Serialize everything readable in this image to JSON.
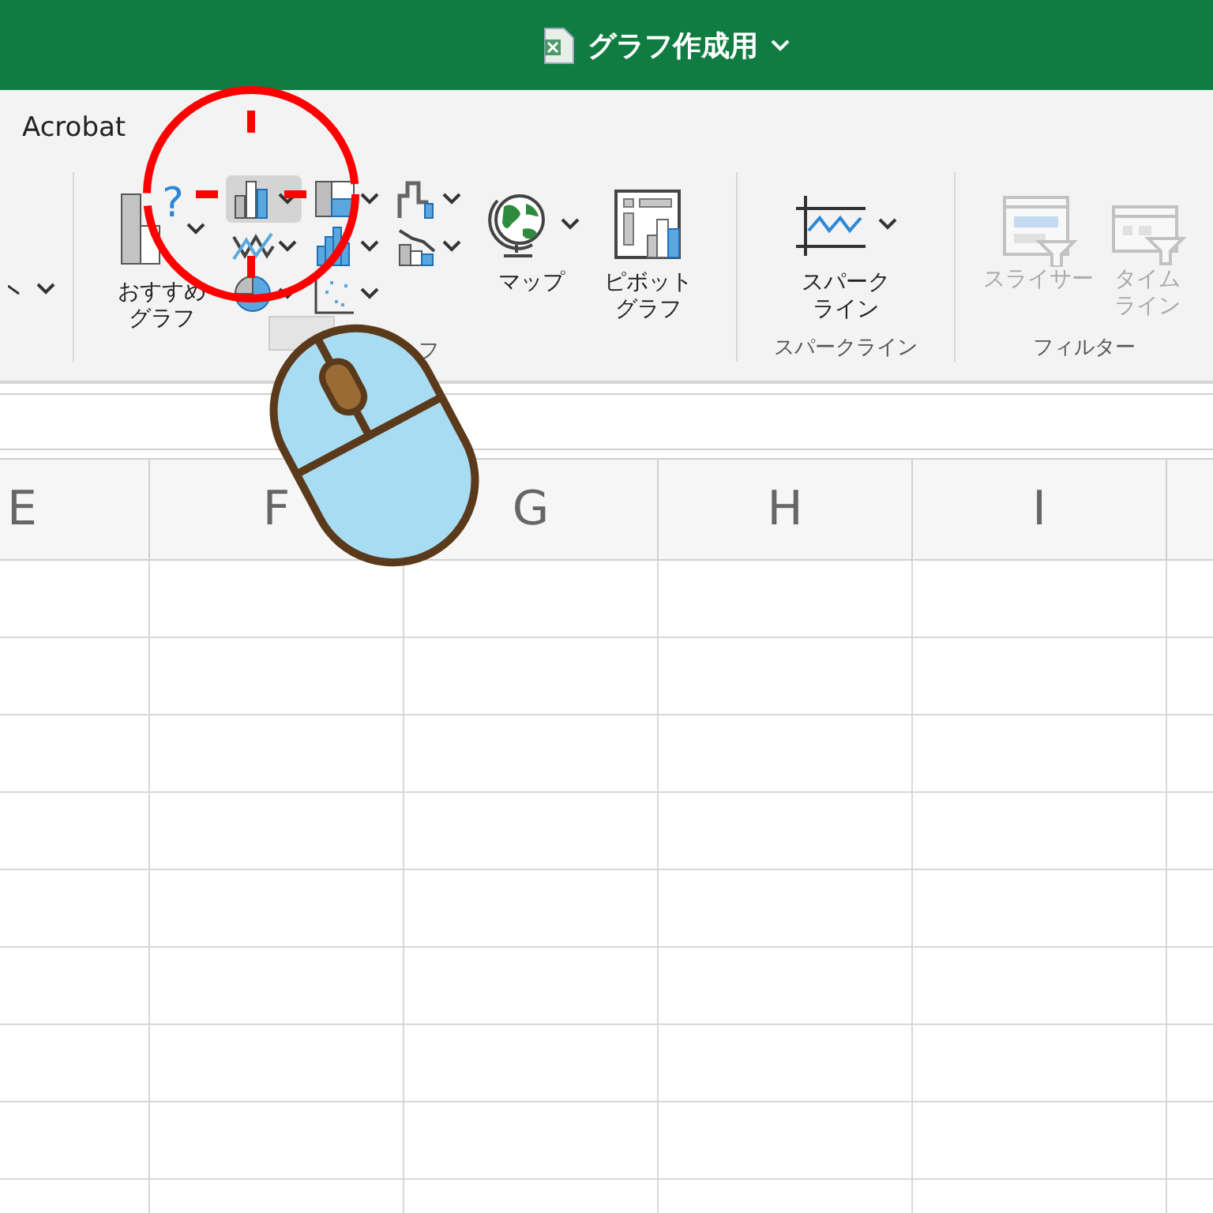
{
  "window": {
    "title": "グラフ作成用"
  },
  "tabs": [
    {
      "label": "Acrobat"
    }
  ],
  "chart_group": {
    "label": "フ",
    "recommended": {
      "glyph": "?",
      "lines": [
        "おすすめ",
        "グラフ"
      ]
    },
    "small_buttons": [
      {
        "kind": "column",
        "selected": true
      },
      {
        "kind": "hierarchy",
        "selected": false
      },
      {
        "kind": "waterfall",
        "selected": false
      },
      {
        "kind": "line",
        "selected": false
      },
      {
        "kind": "statistic",
        "selected": false
      },
      {
        "kind": "combo",
        "selected": false
      },
      {
        "kind": "pie",
        "selected": false
      },
      {
        "kind": "scatter",
        "selected": false
      }
    ],
    "large_buttons": [
      {
        "kind": "map",
        "lines": [
          "マップ"
        ]
      },
      {
        "kind": "pivot",
        "lines": [
          "ピボット",
          "グラフ"
        ]
      }
    ]
  },
  "sparkline_group": {
    "label": "スパークライン",
    "button": {
      "lines": [
        "スパーク",
        "ライン"
      ]
    }
  },
  "filter_group": {
    "label": "フィルター",
    "buttons": [
      {
        "kind": "slicer",
        "lines": [
          "スライサー"
        ],
        "disabled": true
      },
      {
        "kind": "timeline",
        "lines": [
          "タイム",
          "ライン"
        ],
        "disabled": true
      }
    ]
  },
  "columns": [
    "E",
    "F",
    "G",
    "H",
    "I"
  ]
}
